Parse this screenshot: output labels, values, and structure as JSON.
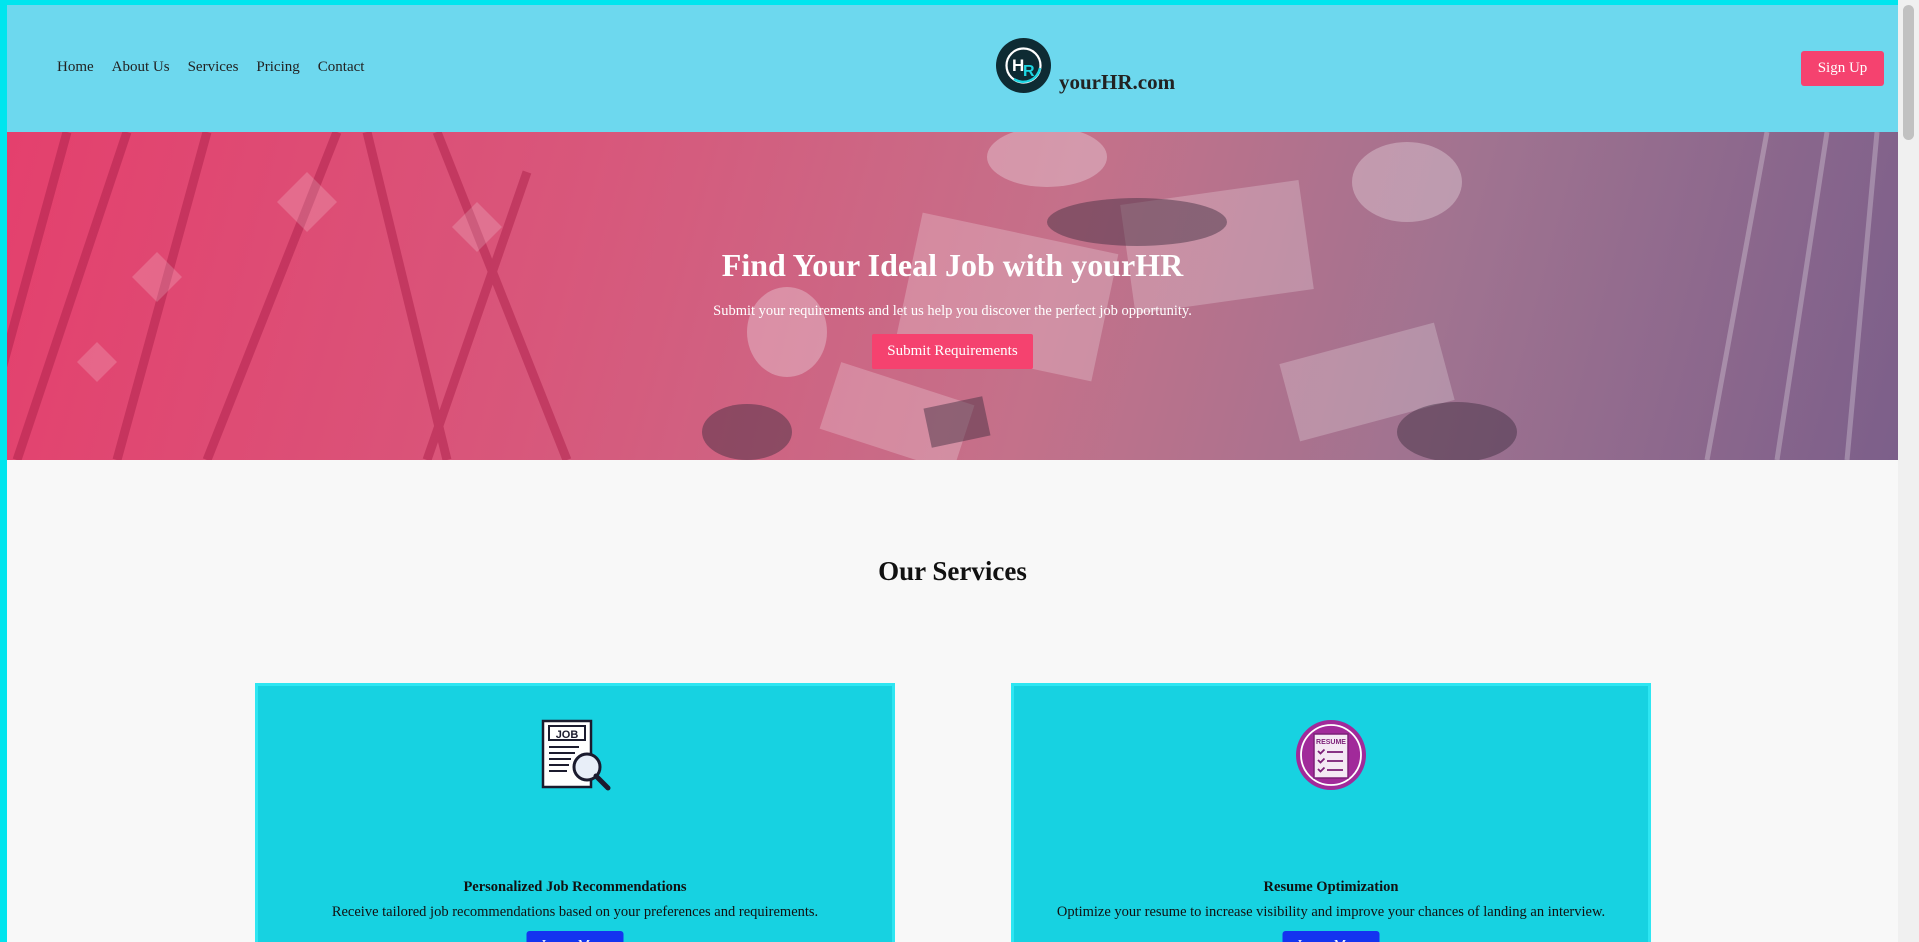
{
  "nav": {
    "items": [
      "Home",
      "About Us",
      "Services",
      "Pricing",
      "Contact"
    ]
  },
  "brand": {
    "name": "yourHR.com",
    "logo_letters": "HR"
  },
  "header": {
    "signup_label": "Sign Up"
  },
  "hero": {
    "title": "Find Your Ideal Job with yourHR",
    "subtitle": "Submit your requirements and let us help you discover the perfect job opportunity.",
    "button_label": "Submit Requirements"
  },
  "services": {
    "title": "Our Services",
    "cards": [
      {
        "icon": "job-search-icon",
        "icon_text": "JOB",
        "title": "Personalized Job Recommendations",
        "description": "Receive tailored job recommendations based on your preferences and requirements.",
        "button_label": "Learn More"
      },
      {
        "icon": "resume-icon",
        "icon_text": "RESUME",
        "title": "Resume Optimization",
        "description": "Optimize your resume to increase visibility and improve your chances of landing an interview.",
        "button_label": "Learn More"
      }
    ]
  },
  "colors": {
    "header_bg": "#6dd8ee",
    "accent": "#f5426f",
    "card_bg": "#17d2e1",
    "card_button": "#1434f0",
    "page_border": "#00e5ee"
  }
}
